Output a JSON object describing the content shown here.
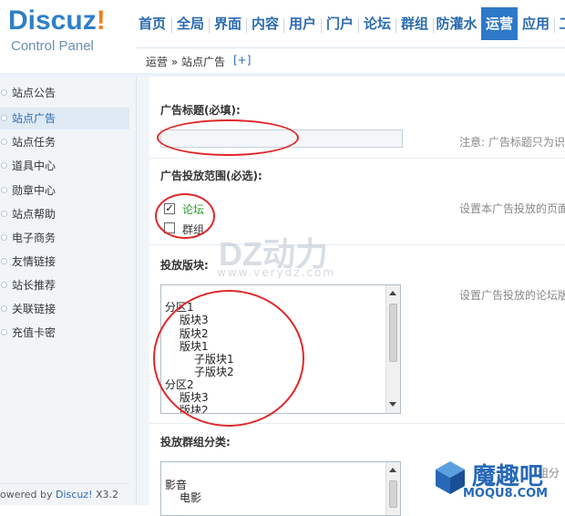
{
  "logo": {
    "brand": "Discuz",
    "excl": "!",
    "sub": "Control Panel"
  },
  "topnav": [
    "首页",
    "全局",
    "界面",
    "内容",
    "用户",
    "门户",
    "论坛",
    "群组",
    "防灌水",
    "运营",
    "应用",
    "工"
  ],
  "topnav_active": "运营",
  "breadcrumb": {
    "path": "运营 » 站点广告",
    "add": "[+]"
  },
  "sidebar": [
    "站点公告",
    "站点广告",
    "站点任务",
    "道具中心",
    "勋章中心",
    "站点帮助",
    "电子商务",
    "友情链接",
    "站长推荐",
    "关联链接",
    "充值卡密"
  ],
  "sidebar_active": "站点广告",
  "powered": {
    "prefix": "owered by ",
    "brand": "Discuz!",
    "version": " X3.2"
  },
  "form": {
    "title_label": "广告标题(必填):",
    "title_note": "注意: 广告标题只为识",
    "scope_label": "广告投放范围(必选):",
    "scope_note": "设置本广告投放的页面",
    "scope_options": [
      {
        "label": "论坛",
        "checked": true
      },
      {
        "label": "群组",
        "checked": false
      }
    ],
    "forum_label": "投放版块:",
    "forum_note": "设置广告投放的论坛版",
    "forum_options": [
      "分区1",
      "版块3",
      "版块2",
      "版块1",
      "子版块1",
      "子版块2",
      "分区2",
      "版块3",
      "版块2"
    ],
    "group_label": "投放群组分类:",
    "group_note": "组分",
    "group_options": [
      "影音",
      "电影"
    ]
  },
  "watermark": {
    "main": "DZ动力",
    "sub": "www.verydz.com"
  },
  "moqu": {
    "main": "魔趣吧",
    "sub": "MOQU8.COM"
  },
  "colors": {
    "accent": "#2d78c8",
    "annotation_circle": "#e0282a",
    "checked_label": "#2a9a2a"
  }
}
